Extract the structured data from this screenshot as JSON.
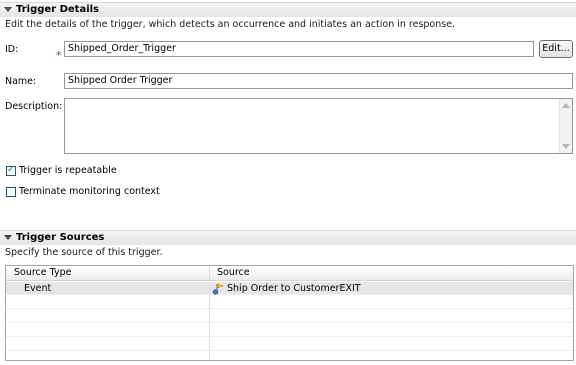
{
  "trigger_details": {
    "title": "Trigger Details",
    "description": "Edit the details of the trigger, which detects an occurrence and initiates an action in response.",
    "id_label": "ID:",
    "id_value": "Shipped_Order_Trigger",
    "edit_button": "Edit...",
    "name_label": "Name:",
    "name_value": "Shipped Order Trigger",
    "description_label": "Description:",
    "description_value": "",
    "repeatable_label": "Trigger is repeatable",
    "repeatable_checked": true,
    "terminate_label": "Terminate monitoring context",
    "terminate_checked": false
  },
  "trigger_sources": {
    "title": "Trigger Sources",
    "description": "Specify the source of this trigger.",
    "columns": [
      "Source Type",
      "Source"
    ],
    "rows": [
      {
        "type": "Event",
        "source": "Ship Order to CustomerEXIT",
        "icon": "event-icon"
      }
    ]
  }
}
